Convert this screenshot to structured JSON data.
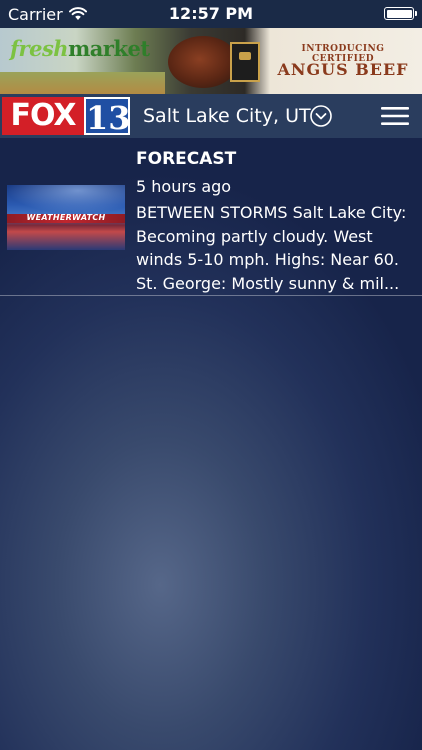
{
  "status_bar": {
    "carrier": "Carrier",
    "time": "12:57 PM",
    "battery_level": 1.0
  },
  "ad": {
    "brand_part1": "fresh",
    "brand_part2": "market",
    "intro": "INTRODUCING CERTIFIED",
    "product": "ANGUS BEEF"
  },
  "header": {
    "logo_fox": "FOX",
    "logo_number": "13",
    "location": "Salt Lake City, UT",
    "dropdown_icon": "chevron-down-circle-icon",
    "menu_icon": "hamburger-menu-icon"
  },
  "feed": {
    "items": [
      {
        "title": "FORECAST",
        "time": "5 hours ago",
        "thumbnail_label": "WEATHERWATCH",
        "body": "BETWEEN STORMS Salt Lake City:\nBecoming partly cloudy.  West\nwinds 5-10 mph.  Highs: Near 60.\nSt. George:  Mostly sunny & mil..."
      }
    ]
  }
}
